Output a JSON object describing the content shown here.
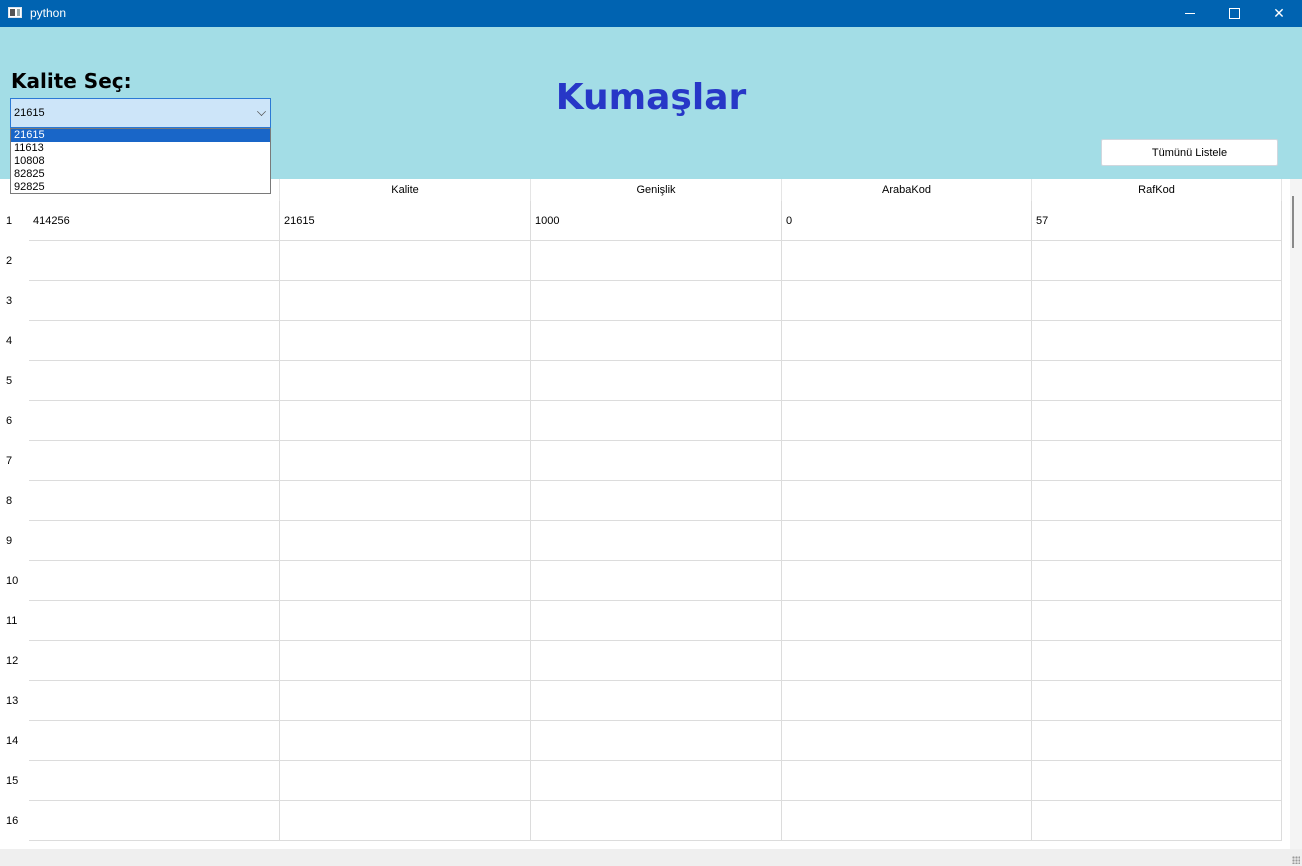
{
  "window": {
    "title": "python",
    "minimize": "–",
    "maximize": "□",
    "close": "✕"
  },
  "header": {
    "kalite_label": "Kalite Seç:",
    "page_title": "Kumaşlar",
    "list_all_button": "Tümünü Listele"
  },
  "combo": {
    "selected": "21615",
    "options": [
      "21615",
      "11613",
      "10808",
      "82825",
      "92825"
    ]
  },
  "table": {
    "columns": [
      "",
      "Kalite",
      "Genişlik",
      "ArabaKod",
      "RafKod"
    ],
    "rows": [
      {
        "num": "1",
        "cells": [
          "414256",
          "21615",
          "1000",
          "0",
          "57"
        ]
      },
      {
        "num": "2",
        "cells": [
          "",
          "",
          "",
          "",
          ""
        ]
      },
      {
        "num": "3",
        "cells": [
          "",
          "",
          "",
          "",
          ""
        ]
      },
      {
        "num": "4",
        "cells": [
          "",
          "",
          "",
          "",
          ""
        ]
      },
      {
        "num": "5",
        "cells": [
          "",
          "",
          "",
          "",
          ""
        ]
      },
      {
        "num": "6",
        "cells": [
          "",
          "",
          "",
          "",
          ""
        ]
      },
      {
        "num": "7",
        "cells": [
          "",
          "",
          "",
          "",
          ""
        ]
      },
      {
        "num": "8",
        "cells": [
          "",
          "",
          "",
          "",
          ""
        ]
      },
      {
        "num": "9",
        "cells": [
          "",
          "",
          "",
          "",
          ""
        ]
      },
      {
        "num": "10",
        "cells": [
          "",
          "",
          "",
          "",
          ""
        ]
      },
      {
        "num": "11",
        "cells": [
          "",
          "",
          "",
          "",
          ""
        ]
      },
      {
        "num": "12",
        "cells": [
          "",
          "",
          "",
          "",
          ""
        ]
      },
      {
        "num": "13",
        "cells": [
          "",
          "",
          "",
          "",
          ""
        ]
      },
      {
        "num": "14",
        "cells": [
          "",
          "",
          "",
          "",
          ""
        ]
      },
      {
        "num": "15",
        "cells": [
          "",
          "",
          "",
          "",
          ""
        ]
      },
      {
        "num": "16",
        "cells": [
          "",
          "",
          "",
          "",
          ""
        ]
      }
    ]
  }
}
